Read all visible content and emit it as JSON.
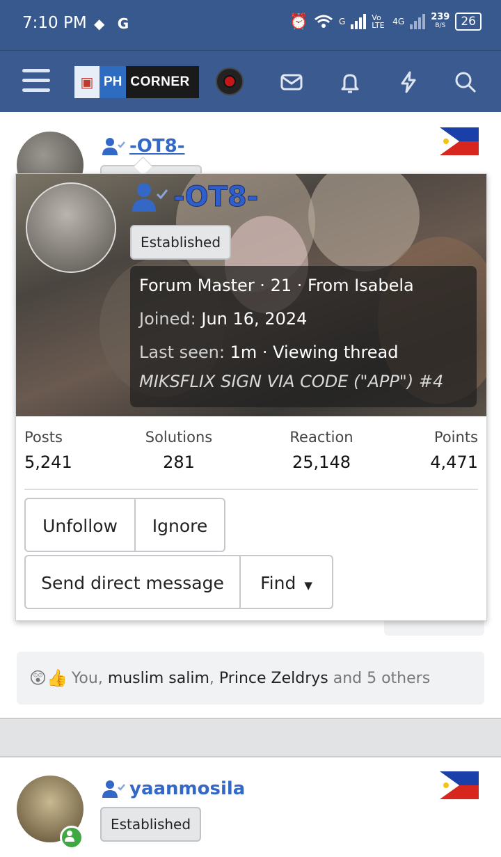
{
  "status_bar": {
    "time": "7:10 PM",
    "network_g": "G",
    "volte": "Vo LTE",
    "net_4g": "4G",
    "speed_value": "239",
    "speed_unit": "B/S",
    "battery": "26"
  },
  "header": {
    "logo_ph": "PH",
    "logo_corner": "CORNER"
  },
  "post1": {
    "username": "-OT8-"
  },
  "member_card": {
    "username": "-OT8-",
    "badge": "Established",
    "title_line": "Forum Master · 21 · From Isabela",
    "joined_label": "Joined:",
    "joined_value": "Jun 16, 2024",
    "last_seen_label": "Last seen:",
    "last_seen_value": "1m · Viewing thread",
    "viewing_thread": "MIKSFLIX SIGN VIA CODE (\"APP\") #4",
    "stats": [
      {
        "label": "Posts",
        "value": "5,241"
      },
      {
        "label": "Solutions",
        "value": "281"
      },
      {
        "label": "Reaction",
        "value": "25,148"
      },
      {
        "label": "Points",
        "value": "4,471"
      }
    ],
    "buttons": {
      "unfollow": "Unfollow",
      "ignore": "Ignore",
      "send_dm": "Send direct message",
      "find": "Find"
    }
  },
  "reactions": {
    "emoji": "😲👍",
    "you": "You, ",
    "name1": "muslim salim",
    "sep": ", ",
    "name2": "Prince Zeldrys",
    "rest": " and 5 others"
  },
  "post2": {
    "username": "yaanmosila",
    "badge": "Established"
  },
  "colors": {
    "header": "#3b5a8f",
    "link_blue": "#3468c6",
    "online": "#3fa842"
  }
}
